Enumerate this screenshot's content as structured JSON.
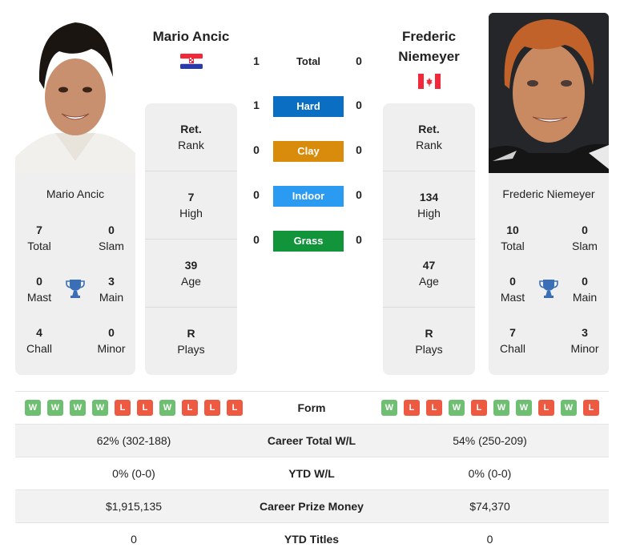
{
  "colors": {
    "hard": "#0a6fc2",
    "clay": "#d98b0b",
    "indoor": "#2a9bf0",
    "grass": "#12943a",
    "win": "#6fbf73",
    "loss": "#ee5a41",
    "trophy": "#3a6fb8"
  },
  "players": [
    {
      "name": "Mario Ancic",
      "flag": "croatia-flag",
      "photo": "player-photo",
      "card_name": "Mario Ancic",
      "titles": {
        "total": {
          "value": "7",
          "label": "Total"
        },
        "slam": {
          "value": "0",
          "label": "Slam"
        },
        "mast": {
          "value": "0",
          "label": "Mast"
        },
        "main": {
          "value": "3",
          "label": "Main"
        },
        "chall": {
          "value": "4",
          "label": "Chall"
        },
        "minor": {
          "value": "0",
          "label": "Minor"
        }
      },
      "info": [
        {
          "value": "Ret.",
          "label": "Rank"
        },
        {
          "value": "7",
          "label": "High"
        },
        {
          "value": "39",
          "label": "Age"
        },
        {
          "value": "R",
          "label": "Plays"
        }
      ],
      "form": [
        "W",
        "W",
        "W",
        "W",
        "L",
        "L",
        "W",
        "L",
        "L",
        "L"
      ],
      "career_wl": "62% (302-188)",
      "ytd_wl": "0% (0-0)",
      "prize_money": "$1,915,135",
      "ytd_titles": "0"
    },
    {
      "name": "Frederic Niemeyer",
      "name_line1": "Frederic",
      "name_line2": "Niemeyer",
      "flag": "canada-flag",
      "photo": "player-photo",
      "card_name": "Frederic Niemeyer",
      "titles": {
        "total": {
          "value": "10",
          "label": "Total"
        },
        "slam": {
          "value": "0",
          "label": "Slam"
        },
        "mast": {
          "value": "0",
          "label": "Mast"
        },
        "main": {
          "value": "0",
          "label": "Main"
        },
        "chall": {
          "value": "7",
          "label": "Chall"
        },
        "minor": {
          "value": "3",
          "label": "Minor"
        }
      },
      "info": [
        {
          "value": "Ret.",
          "label": "Rank"
        },
        {
          "value": "134",
          "label": "High"
        },
        {
          "value": "47",
          "label": "Age"
        },
        {
          "value": "R",
          "label": "Plays"
        }
      ],
      "form": [
        "W",
        "L",
        "L",
        "W",
        "L",
        "W",
        "W",
        "L",
        "W",
        "L"
      ],
      "career_wl": "54% (250-209)",
      "ytd_wl": "0% (0-0)",
      "prize_money": "$74,370",
      "ytd_titles": "0"
    }
  ],
  "h2h": [
    {
      "surface": "Total",
      "left": "1",
      "right": "0",
      "color": null
    },
    {
      "surface": "Hard",
      "left": "1",
      "right": "0",
      "color": "#0a6fc2"
    },
    {
      "surface": "Clay",
      "left": "0",
      "right": "0",
      "color": "#d98b0b"
    },
    {
      "surface": "Indoor",
      "left": "0",
      "right": "0",
      "color": "#2a9bf0"
    },
    {
      "surface": "Grass",
      "left": "0",
      "right": "0",
      "color": "#12943a"
    }
  ],
  "table": {
    "form_label": "Form",
    "career_wl_label": "Career Total W/L",
    "ytd_wl_label": "YTD W/L",
    "prize_label": "Career Prize Money",
    "ytd_titles_label": "YTD Titles"
  }
}
